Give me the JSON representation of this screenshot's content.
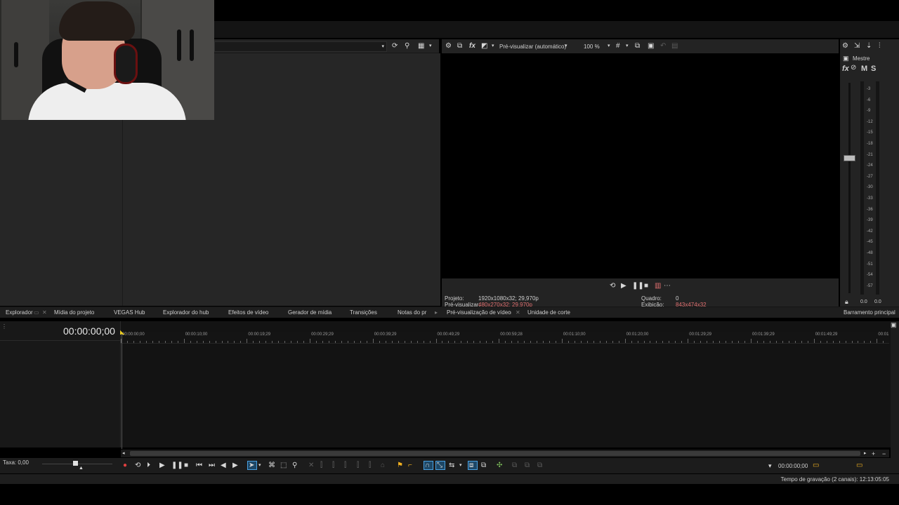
{
  "preview": {
    "mode_label": "Pré-visualizar (automático)",
    "zoom": "100 %",
    "info": {
      "project_label": "Projeto:",
      "project_value": "1920x1080x32; 29,970p",
      "preview_label": "Pré-visualizar:",
      "preview_value": "480x270x32; 29,970p",
      "frame_label": "Quadro:",
      "frame_value": "0",
      "display_label": "Exibição:",
      "display_value": "843x474x32"
    }
  },
  "master": {
    "title": "Mestre",
    "fx_label": "fx",
    "m_label": "M",
    "s_label": "S",
    "scale": [
      "3",
      "6",
      "9",
      "12",
      "15",
      "18",
      "21",
      "24",
      "27",
      "30",
      "33",
      "36",
      "39",
      "42",
      "45",
      "48",
      "51",
      "54",
      "57"
    ],
    "level_left": "0.0",
    "level_right": "0.0"
  },
  "tabs": {
    "explorer": "Explorador",
    "project_media": "Mídia do projeto",
    "vegas_hub": "VEGAS Hub",
    "hub_explorer": "Explorador do hub",
    "video_fx": "Efeitos de vídeo",
    "media_generator": "Gerador de mídia",
    "transitions": "Transições",
    "notes": "Notas do pr",
    "video_preview": "Pré-visualização de vídeo",
    "trimmer": "Unidade de corte",
    "master_bus": "Barramento principal"
  },
  "timeline": {
    "timecode": "00:00:00;00",
    "ruler": [
      "00:00:00;00",
      "00:00:10;00",
      "00:00:19;29",
      "00:00:29;29",
      "00:00:39;29",
      "00:00:49;29",
      "00:00:59;28",
      "00:01:10;00",
      "00:01:20;00",
      "00:01:29;29",
      "00:01:39;29",
      "00:01:49;29",
      "00:01"
    ],
    "rate": "Taxa: 0,00",
    "cursor_time": "00:00:00;00"
  },
  "status": {
    "recording_time": "Tempo de gravação (2 canais): 12:13:05:05"
  },
  "colors": {
    "accent_blue": "#4aa0e0",
    "record_red": "#e04040",
    "marker_yellow": "#f0b020"
  }
}
